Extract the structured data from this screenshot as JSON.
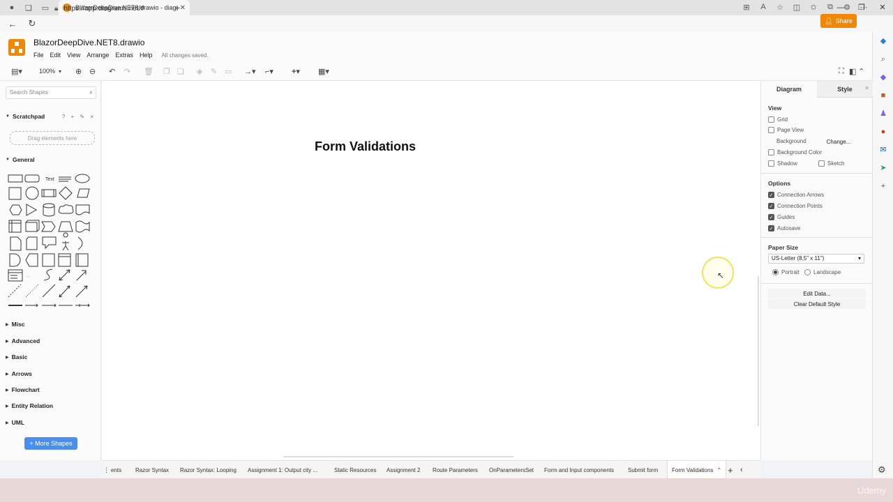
{
  "browser": {
    "tab_title": "BlazorDeepDive.NET8.drawio - diagrams.net",
    "url": "https://app.diagrams.net/#"
  },
  "app": {
    "file_name": "BlazorDeepDive.NET8.drawio",
    "menu": [
      "File",
      "Edit",
      "View",
      "Arrange",
      "Extras",
      "Help"
    ],
    "save_status": "All changes saved.",
    "share_label": "Share",
    "zoom": "100%"
  },
  "left_panel": {
    "search_placeholder": "Search Shapes",
    "scratchpad_label": "Scratchpad",
    "scratchpad_tools": "? + ✎ ×",
    "dropzone_label": "Drag elements here",
    "general_label": "General",
    "sections": [
      "Misc",
      "Advanced",
      "Basic",
      "Arrows",
      "Flowchart",
      "Entity Relation",
      "UML"
    ],
    "more_shapes": "+ More Shapes"
  },
  "canvas": {
    "title": "Form Validations"
  },
  "right_panel": {
    "tabs": [
      "Diagram",
      "Style"
    ],
    "view_heading": "View",
    "grid": "Grid",
    "page_view": "Page View",
    "background": "Background",
    "change": "Change...",
    "background_color": "Background Color",
    "shadow": "Shadow",
    "sketch": "Sketch",
    "options_heading": "Options",
    "connection_arrows": "Connection Arrows",
    "connection_points": "Connection Points",
    "guides": "Guides",
    "autosave": "Autosave",
    "paper_size_heading": "Paper Size",
    "paper_size": "US-Letter (8,5\" x 11\")",
    "portrait": "Portrait",
    "landscape": "Landscape",
    "edit_data": "Edit Data...",
    "clear_default_style": "Clear Default Style"
  },
  "page_tabs": [
    "ents",
    "Razor Syntax",
    "Razor Syntax: Looping",
    "Assignment 1: Output city ...",
    "Static Resources",
    "Assignment 2",
    "Route Parameters",
    "OnParametersSet",
    "Form and Input components",
    "Submit form",
    "Form Validations"
  ],
  "watermark": "Udemy"
}
